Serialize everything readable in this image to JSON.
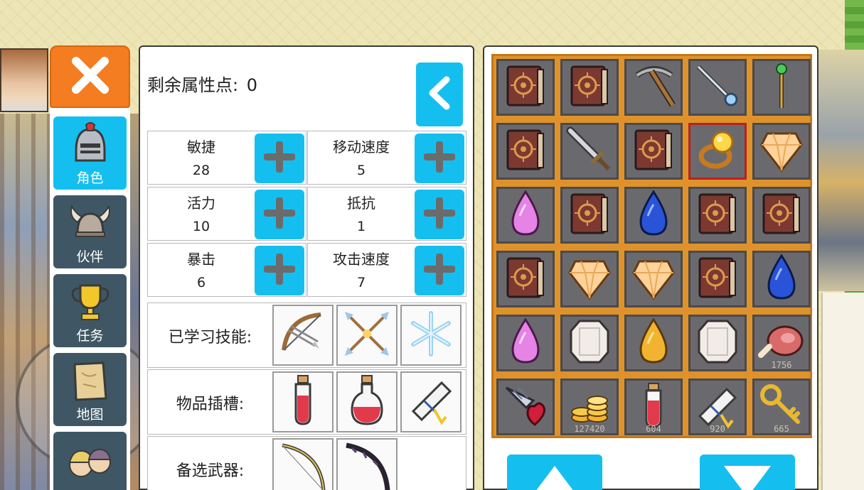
{
  "window": {
    "close_icon": "close-icon"
  },
  "tabs": [
    {
      "label": "角色",
      "icon": "knight-helmet-icon",
      "active": true
    },
    {
      "label": "伙伴",
      "icon": "horned-helmet-icon",
      "active": false
    },
    {
      "label": "任务",
      "icon": "trophy-icon",
      "active": false
    },
    {
      "label": "地图",
      "icon": "map-scroll-icon",
      "active": false
    },
    {
      "label": "",
      "icon": "party-faces-icon",
      "active": false
    }
  ],
  "attributes": {
    "points_label": "剩余属性点:",
    "points_value": "0",
    "stats": [
      {
        "name": "敏捷",
        "value": "28"
      },
      {
        "name": "移动速度",
        "value": "5"
      },
      {
        "name": "活力",
        "value": "10"
      },
      {
        "name": "抵抗",
        "value": "1"
      },
      {
        "name": "暴击",
        "value": "6"
      },
      {
        "name": "攻击速度",
        "value": "7"
      }
    ],
    "skills_label": "已学习技能:",
    "skills": [
      "crossbow-icon",
      "crossed-arrows-icon",
      "snowflake-icon"
    ],
    "item_slots_label": "物品插槽:",
    "item_slots": [
      "red-potion-icon",
      "red-potion-icon",
      "scroll-icon"
    ],
    "weapons_label": "备选武器:",
    "weapons": [
      "bow-icon",
      "dark-bow-icon"
    ]
  },
  "inventory": {
    "items": [
      {
        "icon": "spellbook-icon",
        "count": ""
      },
      {
        "icon": "spellbook-icon",
        "count": ""
      },
      {
        "icon": "pickaxe-icon",
        "count": ""
      },
      {
        "icon": "wand-icon",
        "count": ""
      },
      {
        "icon": "green-staff-icon",
        "count": ""
      },
      {
        "icon": "spellbook-icon",
        "count": ""
      },
      {
        "icon": "sword-icon",
        "count": ""
      },
      {
        "icon": "spellbook-icon",
        "count": ""
      },
      {
        "icon": "gold-ring-icon",
        "count": "",
        "selected": true
      },
      {
        "icon": "amber-gem-icon",
        "count": ""
      },
      {
        "icon": "pink-crystal-icon",
        "count": ""
      },
      {
        "icon": "spellbook-icon",
        "count": ""
      },
      {
        "icon": "blue-crystal-icon",
        "count": ""
      },
      {
        "icon": "spellbook-icon",
        "count": ""
      },
      {
        "icon": "spellbook-icon",
        "count": ""
      },
      {
        "icon": "spellbook-icon",
        "count": ""
      },
      {
        "icon": "amber-gem-icon",
        "count": ""
      },
      {
        "icon": "amber-gem-icon",
        "count": ""
      },
      {
        "icon": "spellbook-icon",
        "count": ""
      },
      {
        "icon": "blue-crystal-icon",
        "count": ""
      },
      {
        "icon": "pink-crystal-icon",
        "count": ""
      },
      {
        "icon": "white-gem-icon",
        "count": ""
      },
      {
        "icon": "gold-crystal-icon",
        "count": ""
      },
      {
        "icon": "white-gem-icon",
        "count": ""
      },
      {
        "icon": "meat-icon",
        "count": "1756"
      },
      {
        "icon": "drill-heart-icon",
        "count": ""
      },
      {
        "icon": "gold-coins-icon",
        "count": "127420"
      },
      {
        "icon": "red-potion-icon",
        "count": "604"
      },
      {
        "icon": "scroll-icon",
        "count": "920"
      },
      {
        "icon": "key-icon",
        "count": "665"
      }
    ],
    "page_up_icon": "triangle-up-icon",
    "page_down_icon": "triangle-down-icon"
  },
  "colors": {
    "accent_blue": "#14bff0",
    "close_orange": "#f47c21",
    "inventory_frame": "#e0922a",
    "tab_inactive": "#3f5764"
  }
}
